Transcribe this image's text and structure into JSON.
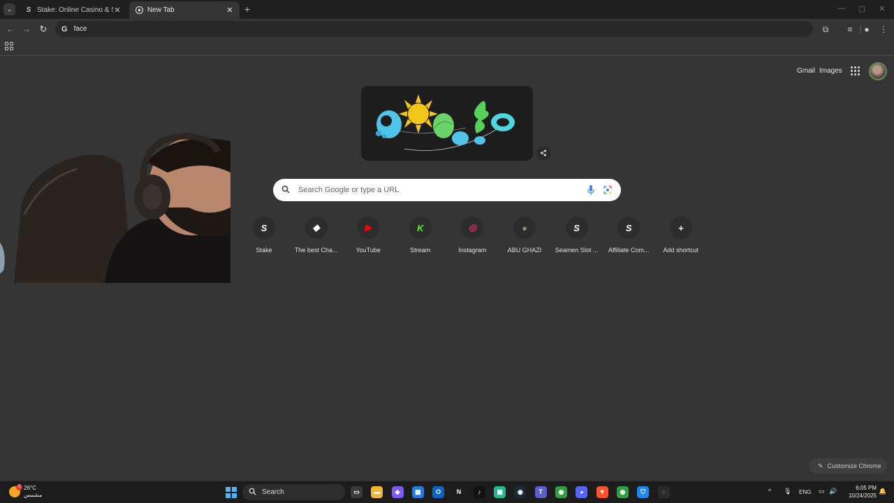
{
  "tabs": [
    {
      "title": "Stake: Online Casino & Sports B",
      "favicon": "stake-s",
      "active": false
    },
    {
      "title": "New Tab",
      "favicon": "chrome-icon",
      "active": true
    }
  ],
  "omnibox": {
    "value": "face"
  },
  "ntp": {
    "links": {
      "gmail": "Gmail",
      "images": "Images"
    },
    "search_placeholder": "Search Google or type a URL",
    "shortcuts": [
      {
        "label": "Stake",
        "icon": "S",
        "color": "#ffffff"
      },
      {
        "label": "The best Cha...",
        "icon": "◆",
        "color": "#ffffff"
      },
      {
        "label": "YouTube",
        "icon": "▶",
        "color": "#ff0000"
      },
      {
        "label": "Stream",
        "icon": "K",
        "color": "#53fc18"
      },
      {
        "label": "Instagram",
        "icon": "◎",
        "color": "#e1306c"
      },
      {
        "label": "ABU GHAZI",
        "icon": "●",
        "color": "#9a8a70"
      },
      {
        "label": "Seamen Slot ...",
        "icon": "S",
        "color": "#ffffff"
      },
      {
        "label": "Affiliate Com...",
        "icon": "S",
        "color": "#ffffff"
      },
      {
        "label": "Add shortcut",
        "icon": "+",
        "color": "#ffffff"
      }
    ],
    "customize_label": "Customize Chrome"
  },
  "taskbar": {
    "weather": {
      "temp": "26°C",
      "condition": "مشمس",
      "badge": "2"
    },
    "search_label": "Search",
    "apps": [
      {
        "name": "task-view-icon",
        "glyph": "▭",
        "bg": "#3a3a3a"
      },
      {
        "name": "file-explorer-icon",
        "glyph": "▬",
        "bg": "#f2b632"
      },
      {
        "name": "copilot-icon",
        "glyph": "◆",
        "bg": "#7a5af8"
      },
      {
        "name": "microsoft-store-icon",
        "glyph": "▦",
        "bg": "#2a7ad8"
      },
      {
        "name": "outlook-icon",
        "glyph": "O",
        "bg": "#0a64c8"
      },
      {
        "name": "netflix-icon",
        "glyph": "N",
        "bg": "#1c1c1c"
      },
      {
        "name": "tiktok-icon",
        "glyph": "♪",
        "bg": "#111111"
      },
      {
        "name": "chat-app-icon",
        "glyph": "▣",
        "bg": "#22b893"
      },
      {
        "name": "steam-icon",
        "glyph": "◉",
        "bg": "#1b2838"
      },
      {
        "name": "teams-icon",
        "glyph": "T",
        "bg": "#5b5fc7"
      },
      {
        "name": "chrome-icon",
        "glyph": "◉",
        "bg": "#2f9e44"
      },
      {
        "name": "discord-icon",
        "glyph": "◕",
        "bg": "#5865f2"
      },
      {
        "name": "brave-icon",
        "glyph": "▼",
        "bg": "#fb542b"
      },
      {
        "name": "chrome-profile-icon",
        "glyph": "◉",
        "bg": "#2f9e44"
      },
      {
        "name": "shield-app-icon",
        "glyph": "⛉",
        "bg": "#1f88e5"
      },
      {
        "name": "obs-icon",
        "glyph": "◌",
        "bg": "#2b2b2b"
      }
    ],
    "tray": {
      "language": "ENG",
      "time": "6:05 PM",
      "date": "10/24/2025"
    }
  }
}
